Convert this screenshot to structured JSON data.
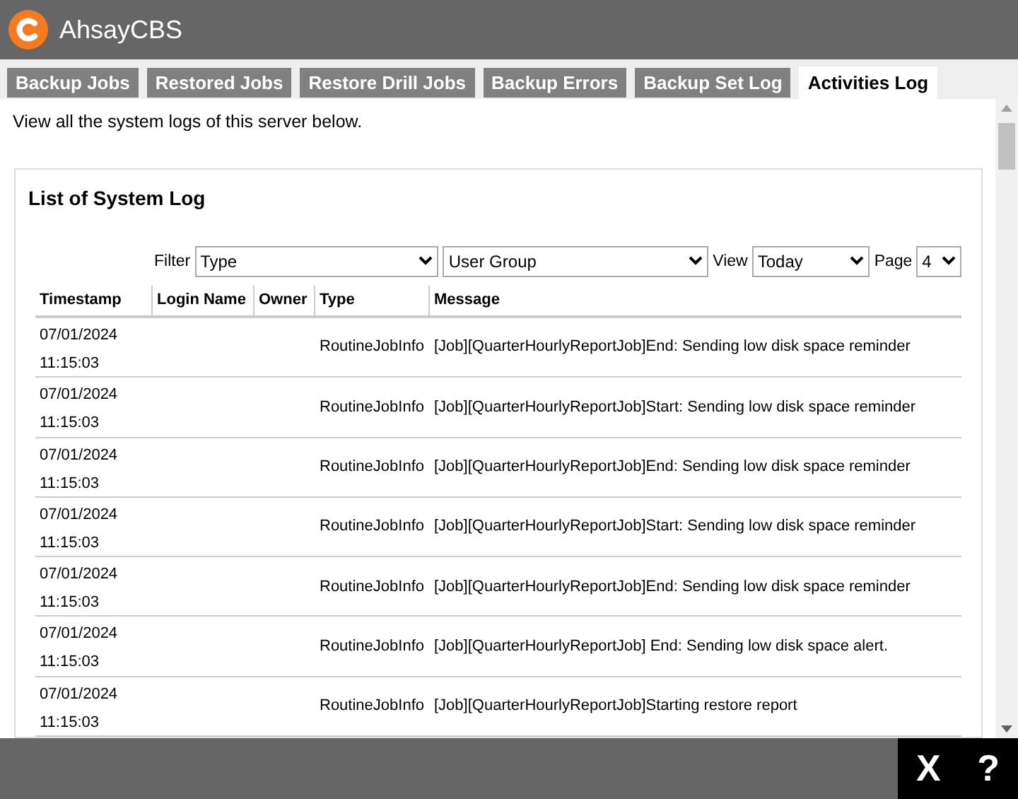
{
  "app": {
    "title": "AhsayCBS"
  },
  "tabs": [
    {
      "label": "Backup Jobs",
      "selected": false
    },
    {
      "label": "Restored Jobs",
      "selected": false
    },
    {
      "label": "Restore Drill Jobs",
      "selected": false
    },
    {
      "label": "Backup Errors",
      "selected": false
    },
    {
      "label": "Backup Set Log",
      "selected": false
    },
    {
      "label": "Activities Log",
      "selected": true
    }
  ],
  "intro": "View all the system logs of this server below.",
  "panel": {
    "title": "List of System Log",
    "filters": [
      {
        "kind": "label",
        "text": "Filter"
      },
      {
        "kind": "select",
        "value": "Type"
      },
      {
        "kind": "select",
        "value": "User Group"
      },
      {
        "kind": "label",
        "text": "View"
      },
      {
        "kind": "select",
        "value": "Today"
      },
      {
        "kind": "label",
        "text": "Page"
      },
      {
        "kind": "select",
        "value": "4"
      }
    ],
    "table": {
      "columns": [
        "Timestamp",
        "Login Name",
        "Owner",
        "Type",
        "Message"
      ],
      "rows": [
        {
          "timestamp": "07/01/2024 11:15:03",
          "type": "RoutineJobInfo",
          "message": "[Job][QuarterHourlyReportJob]End: Sending low disk space reminder"
        },
        {
          "timestamp": "07/01/2024 11:15:03",
          "type": "RoutineJobInfo",
          "message": "[Job][QuarterHourlyReportJob]Start: Sending low disk space reminder"
        },
        {
          "timestamp": "07/01/2024 11:15:03",
          "type": "RoutineJobInfo",
          "message": "[Job][QuarterHourlyReportJob]End: Sending low disk space reminder"
        },
        {
          "timestamp": "07/01/2024 11:15:03",
          "type": "RoutineJobInfo",
          "message": "[Job][QuarterHourlyReportJob]Start: Sending low disk space reminder"
        },
        {
          "timestamp": "07/01/2024 11:15:03",
          "type": "RoutineJobInfo",
          "message": "[Job][QuarterHourlyReportJob]End: Sending low disk space reminder"
        },
        {
          "timestamp": "07/01/2024 11:15:03",
          "type": "RoutineJobInfo",
          "message": "[Job][QuarterHourlyReportJob] End: Sending low disk space alert."
        },
        {
          "timestamp": "07/01/2024 11:15:03",
          "type": "RoutineJobInfo",
          "message": "[Job][QuarterHourlyReportJob]Starting restore report"
        }
      ]
    }
  },
  "footer": {
    "close": "X",
    "help": "?"
  }
}
